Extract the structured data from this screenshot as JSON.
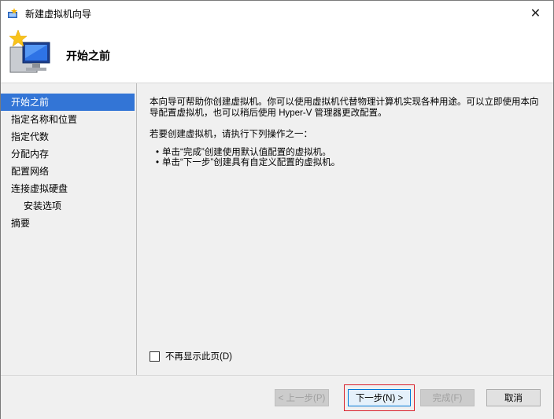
{
  "window": {
    "title": "新建虚拟机向导",
    "close_glyph": "✕"
  },
  "header": {
    "page_title": "开始之前"
  },
  "nav": {
    "items": [
      {
        "label": "开始之前",
        "active": true,
        "sub": false
      },
      {
        "label": "指定名称和位置",
        "active": false,
        "sub": false
      },
      {
        "label": "指定代数",
        "active": false,
        "sub": false
      },
      {
        "label": "分配内存",
        "active": false,
        "sub": false
      },
      {
        "label": "配置网络",
        "active": false,
        "sub": false
      },
      {
        "label": "连接虚拟硬盘",
        "active": false,
        "sub": false
      },
      {
        "label": "安装选项",
        "active": false,
        "sub": true
      },
      {
        "label": "摘要",
        "active": false,
        "sub": false
      }
    ]
  },
  "content": {
    "intro": "本向导可帮助你创建虚拟机。你可以使用虚拟机代替物理计算机实现各种用途。可以立即使用本向导配置虚拟机，也可以稍后使用 Hyper-V 管理器更改配置。",
    "subhead": "若要创建虚拟机，请执行下列操作之一：",
    "bullets": [
      "单击“完成”创建使用默认值配置的虚拟机。",
      "单击“下一步”创建具有自定义配置的虚拟机。"
    ],
    "checkbox_label": "不再显示此页(D)",
    "checkbox_checked": false
  },
  "footer": {
    "prev_label": "< 上一步(P)",
    "next_label": "下一步(N) >",
    "finish_label": "完成(F)",
    "cancel_label": "取消"
  },
  "colors": {
    "nav_active_bg": "#3375d6",
    "highlight_border": "#d9212c"
  }
}
